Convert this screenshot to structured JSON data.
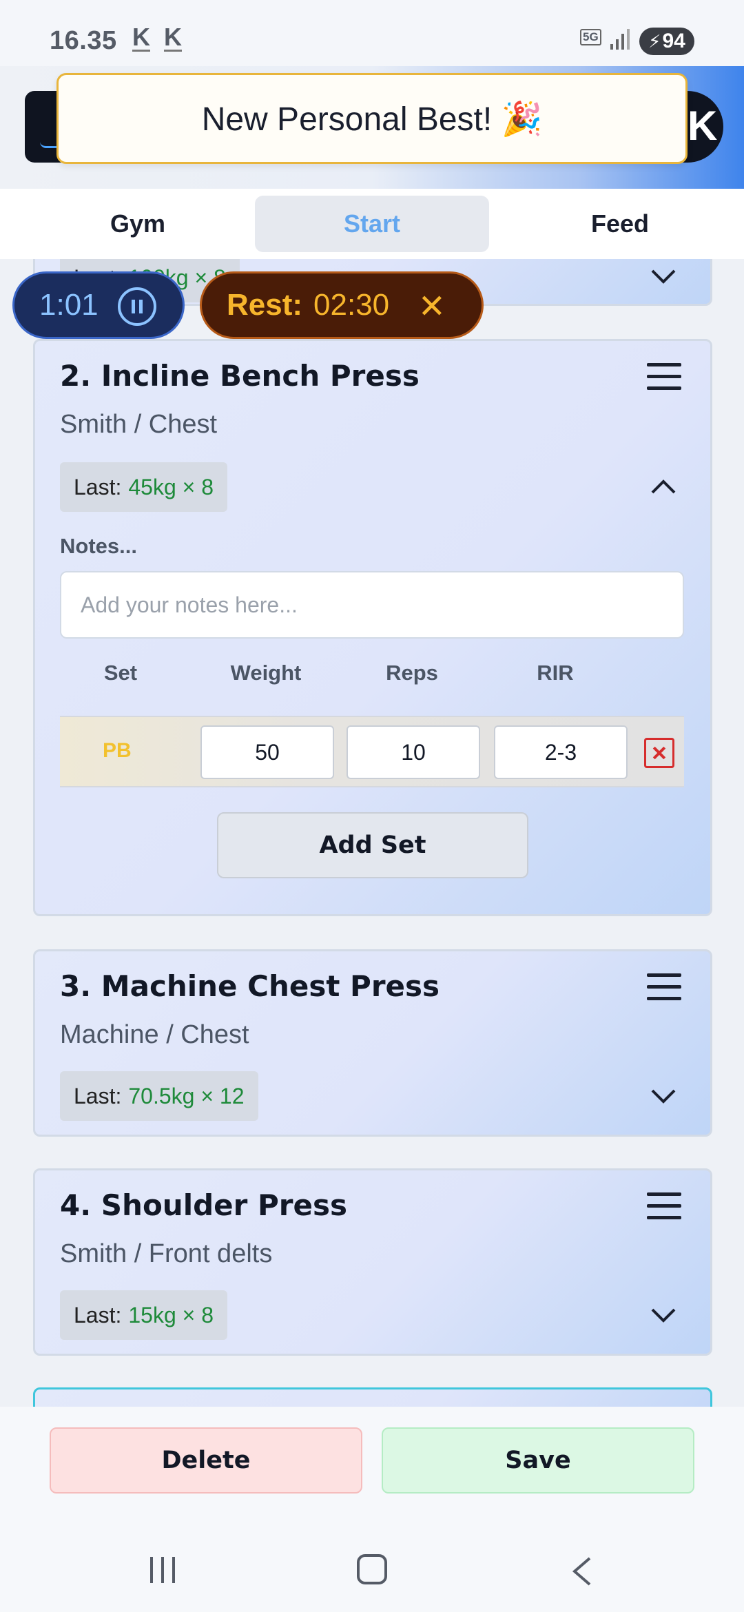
{
  "status_bar": {
    "time": "16.35",
    "indicators": [
      "K",
      "K"
    ],
    "network": "5G",
    "battery": "94",
    "icons": [
      "signal-icon",
      "battery-charging-icon"
    ]
  },
  "toast": {
    "message": "New Personal Best! 🎉"
  },
  "tabs": [
    {
      "label": "Gym",
      "active": false
    },
    {
      "label": "Start",
      "active": true
    },
    {
      "label": "Feed",
      "active": false
    }
  ],
  "timers": {
    "workout": "1:01",
    "rest_label": "Rest:",
    "rest_value": "02:30",
    "rest_close": "✕"
  },
  "exercises": [
    {
      "last_label": "Last:",
      "last_value": "100kg × 8",
      "expanded": false
    },
    {
      "title": "2. Incline Bench Press",
      "subtitle": "Smith / Chest",
      "last_label": "Last:",
      "last_value": "45kg × 8",
      "expanded": true,
      "notes_label": "Notes...",
      "notes_placeholder": "Add your notes here...",
      "columns": [
        "Set",
        "Weight",
        "Reps",
        "RIR"
      ],
      "sets": [
        {
          "set": "PB",
          "weight": "50",
          "reps": "10",
          "rir": "2-3"
        }
      ],
      "add_set_label": "Add Set"
    },
    {
      "title": "3. Machine Chest Press",
      "subtitle": "Machine / Chest",
      "last_label": "Last:",
      "last_value": "70.5kg × 12",
      "expanded": false
    },
    {
      "title": "4. Shoulder Press",
      "subtitle": "Smith / Front delts",
      "last_label": "Last:",
      "last_value": "15kg × 8",
      "expanded": false
    }
  ],
  "footer": {
    "delete_label": "Delete",
    "save_label": "Save"
  },
  "colors": {
    "accent": "#63a6ee",
    "pb_gold": "#f2c12e",
    "last_value_green": "#1e8a3a",
    "rest_bg": "#4a1c07",
    "timer_bg": "#1b2d5e",
    "delete_bg": "#fde1e1",
    "save_bg": "#dcf8e4"
  }
}
